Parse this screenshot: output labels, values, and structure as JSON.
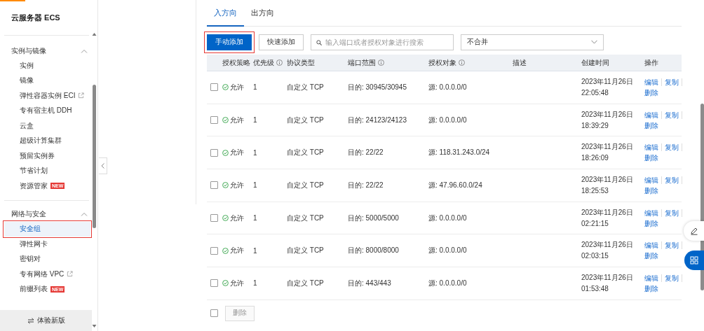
{
  "sidebar": {
    "title": "云服务器 ECS",
    "sections": [
      {
        "title": "实例与镜像",
        "expanded": true,
        "items": [
          {
            "label": "实例",
            "selected": false,
            "highlighted": false
          },
          {
            "label": "镜像",
            "selected": false,
            "highlighted": false
          },
          {
            "label": "弹性容器实例 ECI",
            "selected": false,
            "highlighted": false,
            "external": true
          },
          {
            "label": "专有宿主机 DDH",
            "selected": false,
            "highlighted": false
          },
          {
            "label": "云盒",
            "selected": false,
            "highlighted": false
          },
          {
            "label": "超级计算集群",
            "selected": false,
            "highlighted": false
          },
          {
            "label": "预留实例券",
            "selected": false,
            "highlighted": false
          },
          {
            "label": "节省计划",
            "selected": false,
            "highlighted": false
          },
          {
            "label": "资源管家",
            "selected": false,
            "highlighted": false,
            "badge": "NEW"
          }
        ]
      },
      {
        "title": "网络与安全",
        "expanded": true,
        "items": [
          {
            "label": "安全组",
            "selected": true,
            "highlighted": true
          },
          {
            "label": "弹性网卡",
            "selected": false,
            "highlighted": false
          },
          {
            "label": "密钥对",
            "selected": false,
            "highlighted": false
          },
          {
            "label": "专有网络 VPC",
            "selected": false,
            "highlighted": false,
            "external": true
          },
          {
            "label": "前缀列表",
            "selected": false,
            "highlighted": false,
            "badge": "NEW"
          }
        ]
      }
    ],
    "footer": "体验新版"
  },
  "tabs": [
    {
      "label": "入方向",
      "selected": true
    },
    {
      "label": "出方向",
      "selected": false
    }
  ],
  "toolbar": {
    "buttons": [
      {
        "label": "手动添加",
        "kind": "primary",
        "highlighted": true
      },
      {
        "label": "快速添加",
        "kind": "secondary",
        "highlighted": false
      }
    ],
    "search": {
      "placeholder": "输入端口或者授权对象进行搜索"
    },
    "select": {
      "value": "不合并"
    }
  },
  "table": {
    "columns": [
      {
        "label": "授权策略",
        "info": false
      },
      {
        "label": "优先级",
        "info": true
      },
      {
        "label": "协议类型",
        "info": false
      },
      {
        "label": "端口范围",
        "info": true
      },
      {
        "label": "授权对象",
        "info": true
      },
      {
        "label": "描述",
        "info": false
      },
      {
        "label": "创建时间",
        "info": false
      },
      {
        "label": "操作",
        "info": false
      }
    ],
    "rows": [
      {
        "checked": false,
        "policy": "允许",
        "priority": "1",
        "protocol": "自定义 TCP",
        "port_range": "目的: 30945/30945",
        "auth_object": "源: 0.0.0.0/0",
        "created": "2023年11月26日 22:05:48",
        "actions": [
          "编辑",
          "复制",
          "删除"
        ]
      },
      {
        "checked": false,
        "policy": "允许",
        "priority": "1",
        "protocol": "自定义 TCP",
        "port_range": "目的: 24123/24123",
        "auth_object": "源: 0.0.0.0/0",
        "created": "2023年11月26日 18:39:29",
        "actions": [
          "编辑",
          "复制",
          "删除"
        ]
      },
      {
        "checked": false,
        "policy": "允许",
        "priority": "1",
        "protocol": "自定义 TCP",
        "port_range": "目的: 22/22",
        "auth_object": "源: 118.31.243.0/24",
        "created": "2023年11月26日 18:26:09",
        "actions": [
          "编辑",
          "复制",
          "删除"
        ]
      },
      {
        "checked": false,
        "policy": "允许",
        "priority": "1",
        "protocol": "自定义 TCP",
        "port_range": "目的: 22/22",
        "auth_object": "源: 47.96.60.0/24",
        "created": "2023年11月26日 18:25:53",
        "actions": [
          "编辑",
          "复制",
          "删除"
        ]
      },
      {
        "checked": false,
        "policy": "允许",
        "priority": "1",
        "protocol": "自定义 TCP",
        "port_range": "目的: 5000/5000",
        "auth_object": "源: 0.0.0.0/0",
        "created": "2023年11月26日 02:21:15",
        "actions": [
          "编辑",
          "复制",
          "删除"
        ]
      },
      {
        "checked": false,
        "policy": "允许",
        "priority": "1",
        "protocol": "自定义 TCP",
        "port_range": "目的: 8000/8000",
        "auth_object": "源: 0.0.0.0/0",
        "created": "2023年11月26日 02:03:15",
        "actions": [
          "编辑",
          "复制",
          "删除"
        ]
      },
      {
        "checked": false,
        "policy": "允许",
        "priority": "1",
        "protocol": "自定义 TCP",
        "port_range": "目的: 443/443",
        "auth_object": "源: 0.0.0.0/0",
        "created": "2023年11月26日 01:53:48",
        "actions": [
          "编辑",
          "复制",
          "删除"
        ]
      }
    ],
    "footer": {
      "select_all_checked": false,
      "delete_button": {
        "label": "删除",
        "disabled": true
      }
    }
  }
}
